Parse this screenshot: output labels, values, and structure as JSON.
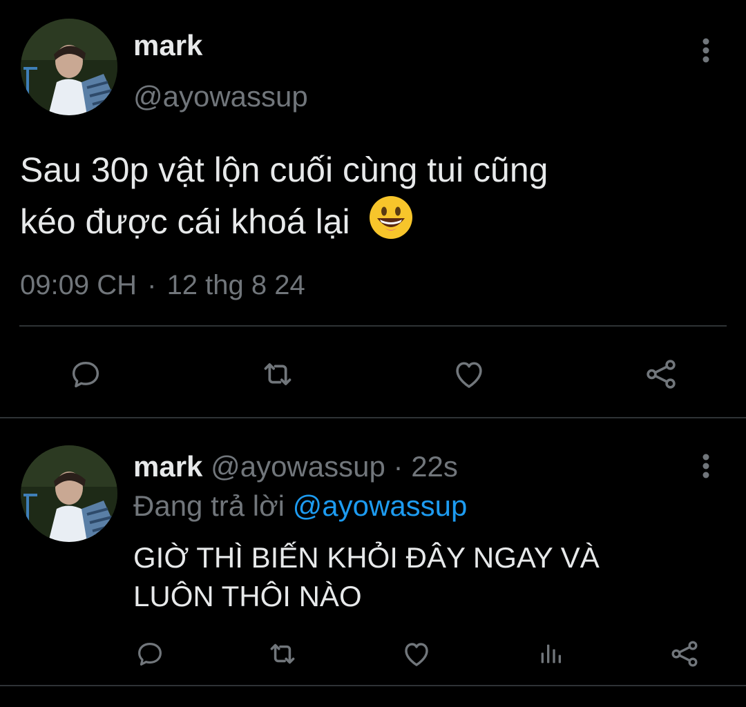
{
  "main_tweet": {
    "author_name": "mark",
    "author_handle": "@ayowassup",
    "text_line1": "Sau 30p vật lộn cuối cùng tui cũng",
    "text_line2": "kéo được cái khoá lại",
    "emoji": "😃",
    "timestamp": "09:09 CH",
    "separator": "·",
    "date": "12 thg 8 24",
    "actions": [
      "reply-icon",
      "retweet-icon",
      "like-icon",
      "share-icon"
    ]
  },
  "reply_tweet": {
    "author_name": "mark",
    "author_handle": "@ayowassup",
    "separator": "·",
    "time_ago": "22s",
    "replying_label": "Đang trả lời",
    "replying_handle": "@ayowassup",
    "text_line1": "GIỜ THÌ BIẾN KHỎI ĐÂY NGAY VÀ",
    "text_line2": "LUÔN THÔI NÀO",
    "actions": [
      "reply-icon",
      "retweet-icon",
      "like-icon",
      "analytics-icon",
      "share-icon"
    ]
  },
  "colors": {
    "background": "#000000",
    "text": "#e7e9ea",
    "muted": "#71767b",
    "link": "#1d9bf0",
    "divider": "#2f3336"
  }
}
